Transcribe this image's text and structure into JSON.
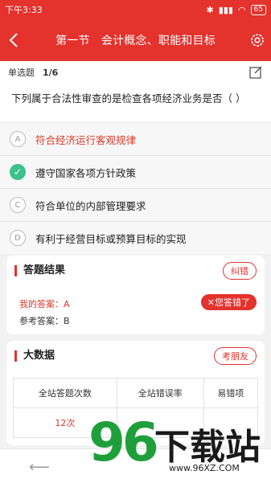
{
  "status": {
    "time": "下午3:33",
    "battery": "65"
  },
  "header": {
    "title": "第一节　会计概念、职能和目标"
  },
  "question": {
    "type": "单选题",
    "counter": "1/6",
    "text": "下列属于合法性审查的是检查各项经济业务是否（ ）"
  },
  "options": [
    {
      "letter": "A",
      "text": "符合经济运行客观规律",
      "state": "wrong"
    },
    {
      "letter": "✓",
      "text": "遵守国家各项方针政策",
      "state": "correct"
    },
    {
      "letter": "C",
      "text": "符合单位的内部管理要求",
      "state": "normal"
    },
    {
      "letter": "D",
      "text": "有利于经营目标或预算目标的实现",
      "state": "normal"
    }
  ],
  "result_card": {
    "title": "答题结果",
    "correct_btn": "纠错",
    "my_answer": "我的答案：A",
    "ref_answer": "参考答案：B",
    "wrong_badge": "您答错了"
  },
  "stats_card": {
    "title": "大数据",
    "challenge_btn": "考朋友",
    "headers": [
      "全站答题次数",
      "全站错误率",
      "易错项"
    ],
    "values": [
      "12次",
      "",
      ""
    ]
  },
  "watermark": {
    "number": "96",
    "text": "下载站",
    "url": "www.96XZ.COM"
  },
  "colors": {
    "brand": "#e4322d",
    "correct": "#3cc28a"
  }
}
